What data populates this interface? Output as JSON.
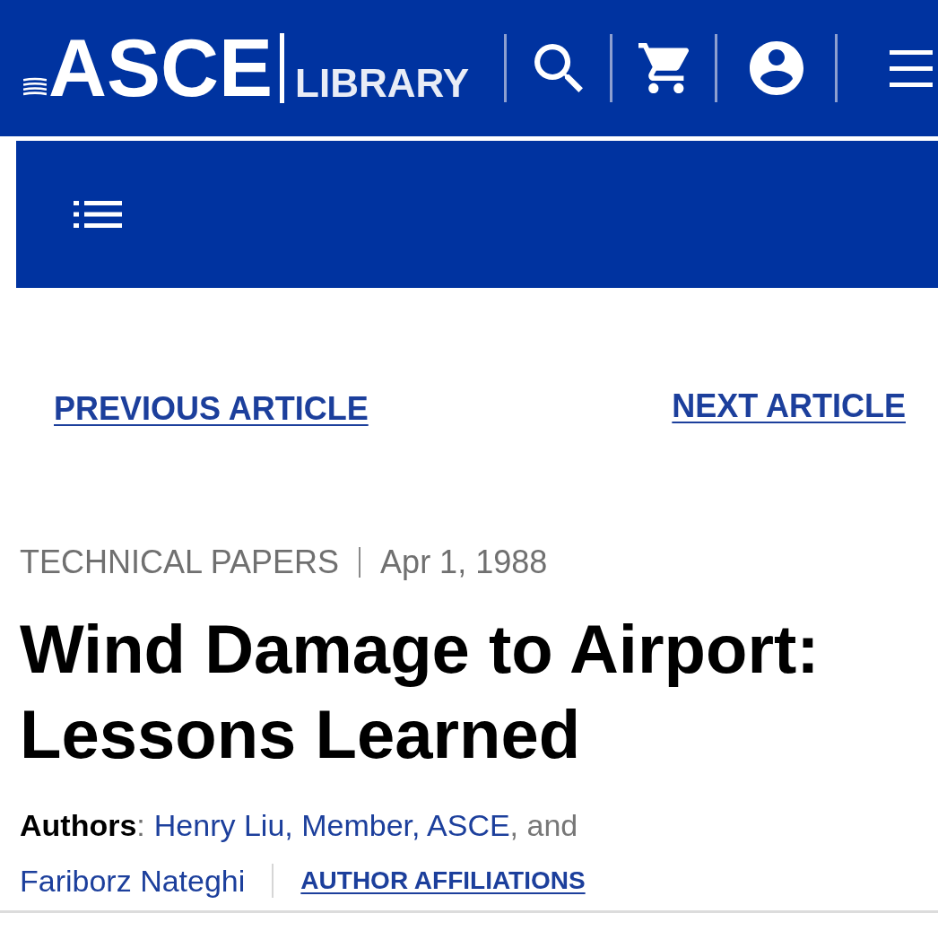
{
  "header": {
    "logo": {
      "wordmark": "ASCE",
      "subtitle": "LIBRARY"
    },
    "actions": [
      {
        "kind": "search"
      },
      {
        "kind": "cart"
      },
      {
        "kind": "account"
      },
      {
        "kind": "menu"
      }
    ]
  },
  "article_nav": {
    "previous": "PREVIOUS ARTICLE",
    "next": "NEXT ARTICLE"
  },
  "meta": {
    "section": "TECHNICAL PAPERS",
    "date": "Apr 1, 1988"
  },
  "title": "Wind Damage to Airport: Lessons Learned",
  "authors": {
    "label": "**Authors**:",
    "names": [
      "Henry Liu, Member, ASCE",
      "Fariborz Nateghi"
    ],
    "conjunction": ", and",
    "affiliations_link": "AUTHOR AFFILIATIONS"
  }
}
